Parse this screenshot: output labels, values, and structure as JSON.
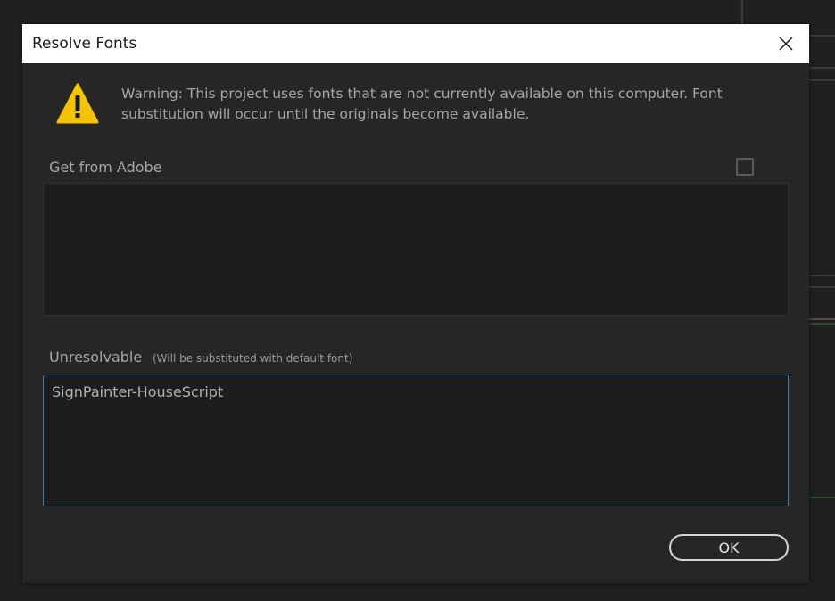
{
  "dialog": {
    "title": "Resolve Fonts",
    "warning_text": "Warning: This project uses fonts that are not currently available on this computer. Font substitution will occur until the originals become available.",
    "get_from_adobe": {
      "label": "Get from Adobe",
      "checked": false,
      "items": []
    },
    "unresolvable": {
      "label": "Unresolvable",
      "hint": "(Will be substituted with default font)",
      "items": [
        "SignPainter-HouseScript"
      ]
    },
    "ok_label": "OK"
  },
  "colors": {
    "warning_icon": "#f5c400",
    "focus_border": "#3c78b5",
    "background": "#202020",
    "dialog_background": "#262626"
  },
  "icons": [
    "warning-triangle-icon",
    "close-icon"
  ]
}
